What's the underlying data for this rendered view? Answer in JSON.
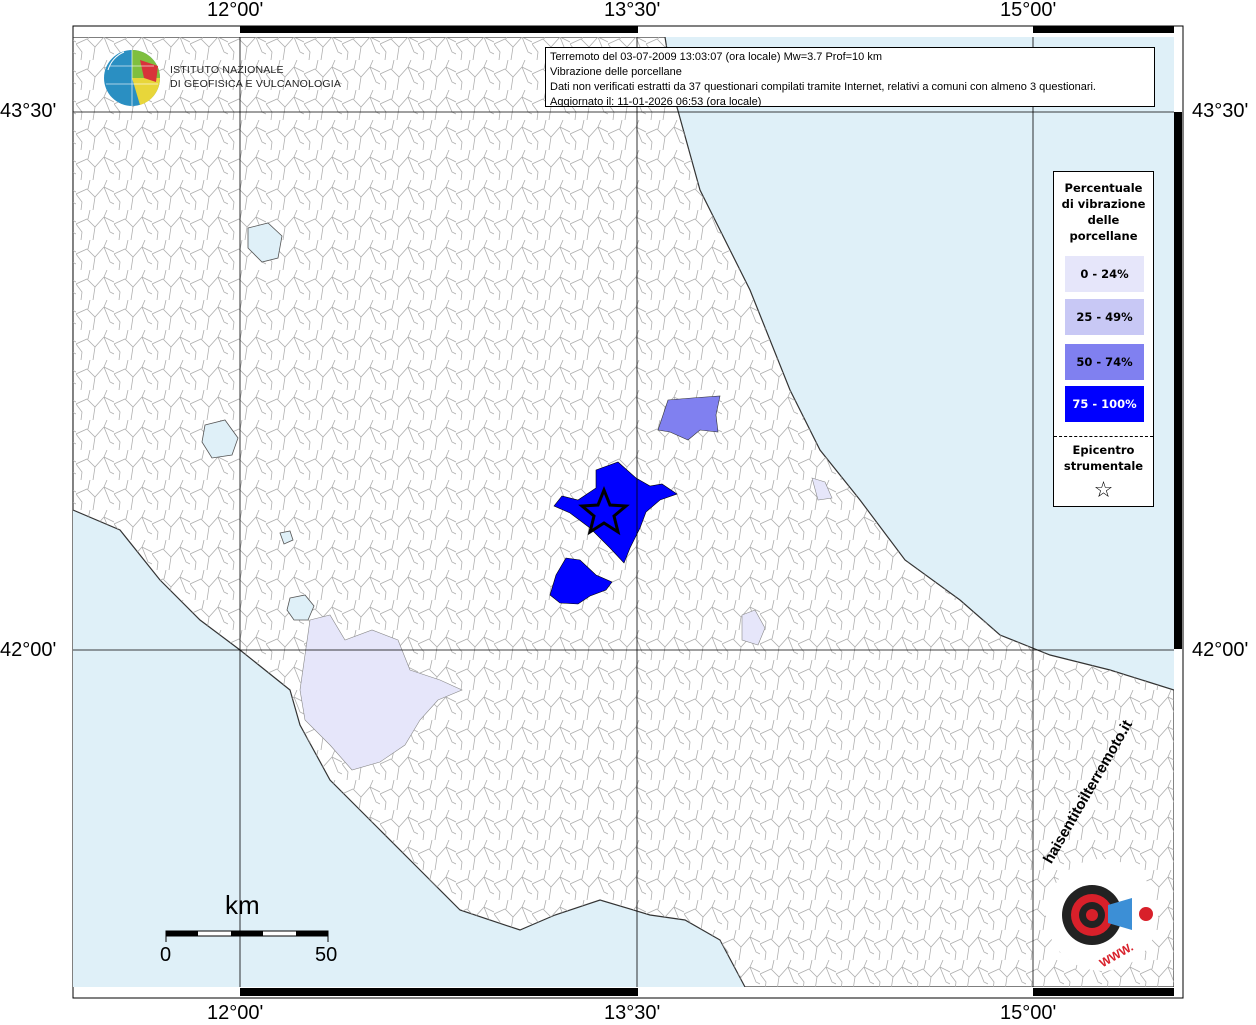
{
  "map": {
    "lon_labels": [
      "12°00'",
      "13°30'",
      "15°00'"
    ],
    "lat_labels": [
      "43°30'",
      "42°00'"
    ],
    "colors": {
      "sea": "#dff0f8",
      "land": "#ffffff",
      "borders": "#9a9a9a",
      "grid": "#000000"
    }
  },
  "info": {
    "line1": "Terremoto del 03-07-2009 13:03:07 (ora locale) Mw=3.7 Prof=10 km",
    "line2": "Vibrazione delle porcellane",
    "line3": "Dati non verificati estratti da 37 questionari compilati tramite Internet, relativi a comuni con almeno 3 questionari.",
    "line4": "Aggiornato il: 11-01-2026 06:53 (ora locale)"
  },
  "legend": {
    "title_lines": [
      "Percentuale",
      "di vibrazione",
      "delle",
      "porcellane"
    ],
    "items": [
      {
        "label": "0 - 24%",
        "color": "#e6e6fa"
      },
      {
        "label": "25 - 49%",
        "color": "#c8c8f5"
      },
      {
        "label": "50 - 74%",
        "color": "#8080f0"
      },
      {
        "label": "75 - 100%",
        "color": "#0000ff"
      }
    ],
    "epicenter_lines": [
      "Epicentro",
      "strumentale"
    ],
    "epicenter_symbol": "☆"
  },
  "logo": {
    "line1": "ISTITUTO NAZIONALE",
    "line2": "DI GEOFISICA E VULCANOLOGIA"
  },
  "scale": {
    "unit": "km",
    "min": "0",
    "max": "50"
  },
  "haisentito": {
    "text": "haisentitoilterremoto.it",
    "www": "WWW."
  }
}
